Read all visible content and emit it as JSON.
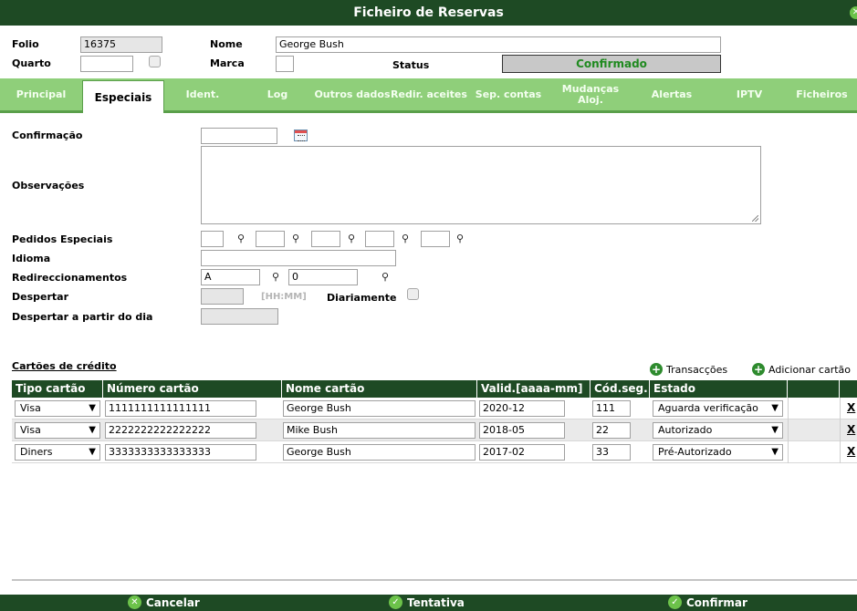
{
  "window": {
    "title": "Ficheiro de Reservas"
  },
  "header": {
    "folio_label": "Folio",
    "folio_value": "16375",
    "quarto_label": "Quarto",
    "quarto_value": "",
    "nome_label": "Nome",
    "nome_value": "George Bush",
    "marca_label": "Marca",
    "status_label": "Status",
    "status_value": "Confirmado"
  },
  "tabs": [
    {
      "label": "Principal"
    },
    {
      "label": "Especiais"
    },
    {
      "label": "Ident."
    },
    {
      "label": "Log"
    },
    {
      "label": "Outros dados"
    },
    {
      "label": "Redir. aceites"
    },
    {
      "label": "Sep. contas"
    },
    {
      "label": "Mudanças Aloj."
    },
    {
      "label": "Alertas"
    },
    {
      "label": "IPTV"
    },
    {
      "label": "Ficheiros"
    }
  ],
  "form": {
    "confirmacao_label": "Confirmação",
    "observacoes_label": "Observações",
    "pedidos_label": "Pedidos Especiais",
    "idioma_label": "Idioma",
    "redir_label": "Redireccionamentos",
    "redir_value1": "A",
    "redir_value2": "0",
    "despertar_label": "Despertar",
    "despertar_hint": "[HH:MM]",
    "diariamente_label": "Diariamente",
    "despertar_dia_label": "Despertar a partir do dia"
  },
  "cards": {
    "section_title": "Cartões de crédito",
    "transacoes_label": "Transacções",
    "adicionar_label": "Adicionar cartão",
    "columns": [
      "Tipo cartão",
      "Número cartão",
      "Nome cartão",
      "Valid.[aaaa-mm]",
      "Cód.seg.",
      "Estado"
    ],
    "rows": [
      {
        "tipo": "Visa",
        "numero": "1111111111111111",
        "nome": "George Bush",
        "valid": "2020-12",
        "cod": "111",
        "estado": "Aguarda verificação",
        "delete": "X"
      },
      {
        "tipo": "Visa",
        "numero": "2222222222222222",
        "nome": "Mike Bush",
        "valid": "2018-05",
        "cod": "22",
        "estado": "Autorizado",
        "delete": "X"
      },
      {
        "tipo": "Diners",
        "numero": "3333333333333333",
        "nome": "George Bush",
        "valid": "2017-02",
        "cod": "33",
        "estado": "Pré-Autorizado",
        "delete": "X"
      }
    ]
  },
  "footer": {
    "cancel_label": "Cancelar",
    "tentativa_label": "Tentativa",
    "confirm_label": "Confirmar"
  },
  "colors": {
    "dark_green": "#1e4a24",
    "tab_green": "#8fcf7a",
    "status_green": "#1f8a1f"
  }
}
